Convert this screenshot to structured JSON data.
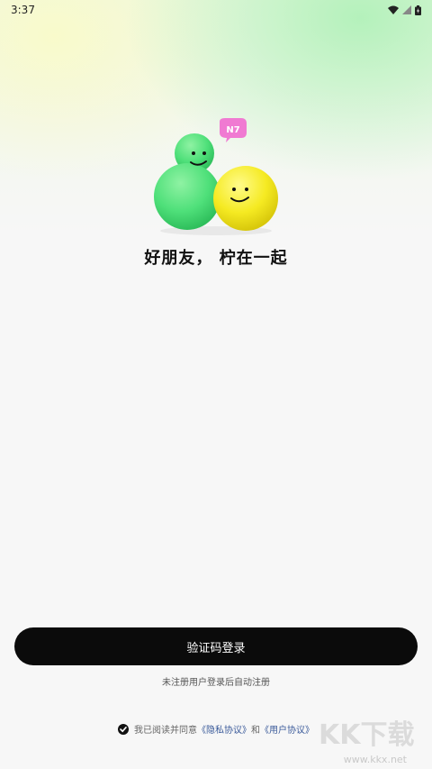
{
  "status_bar": {
    "time": "3:37"
  },
  "mascot": {
    "badge_text": "N7"
  },
  "tagline": "好朋友， 柠在一起",
  "login_button_label": "验证码登录",
  "auto_register_note": "未注册用户登录后自动注册",
  "agreement": {
    "prefix": "我已阅读并同意",
    "privacy_link": "《隐私协议》",
    "conjunction": "和",
    "user_link": "《用户协议》",
    "checked": true
  },
  "watermark": {
    "text": "KK下载",
    "url": "www.kkx.net"
  },
  "colors": {
    "green_mascot": "#4fe07a",
    "yellow_mascot": "#f5ea22",
    "badge": "#f07ad2",
    "button": "#0b0b0b"
  }
}
